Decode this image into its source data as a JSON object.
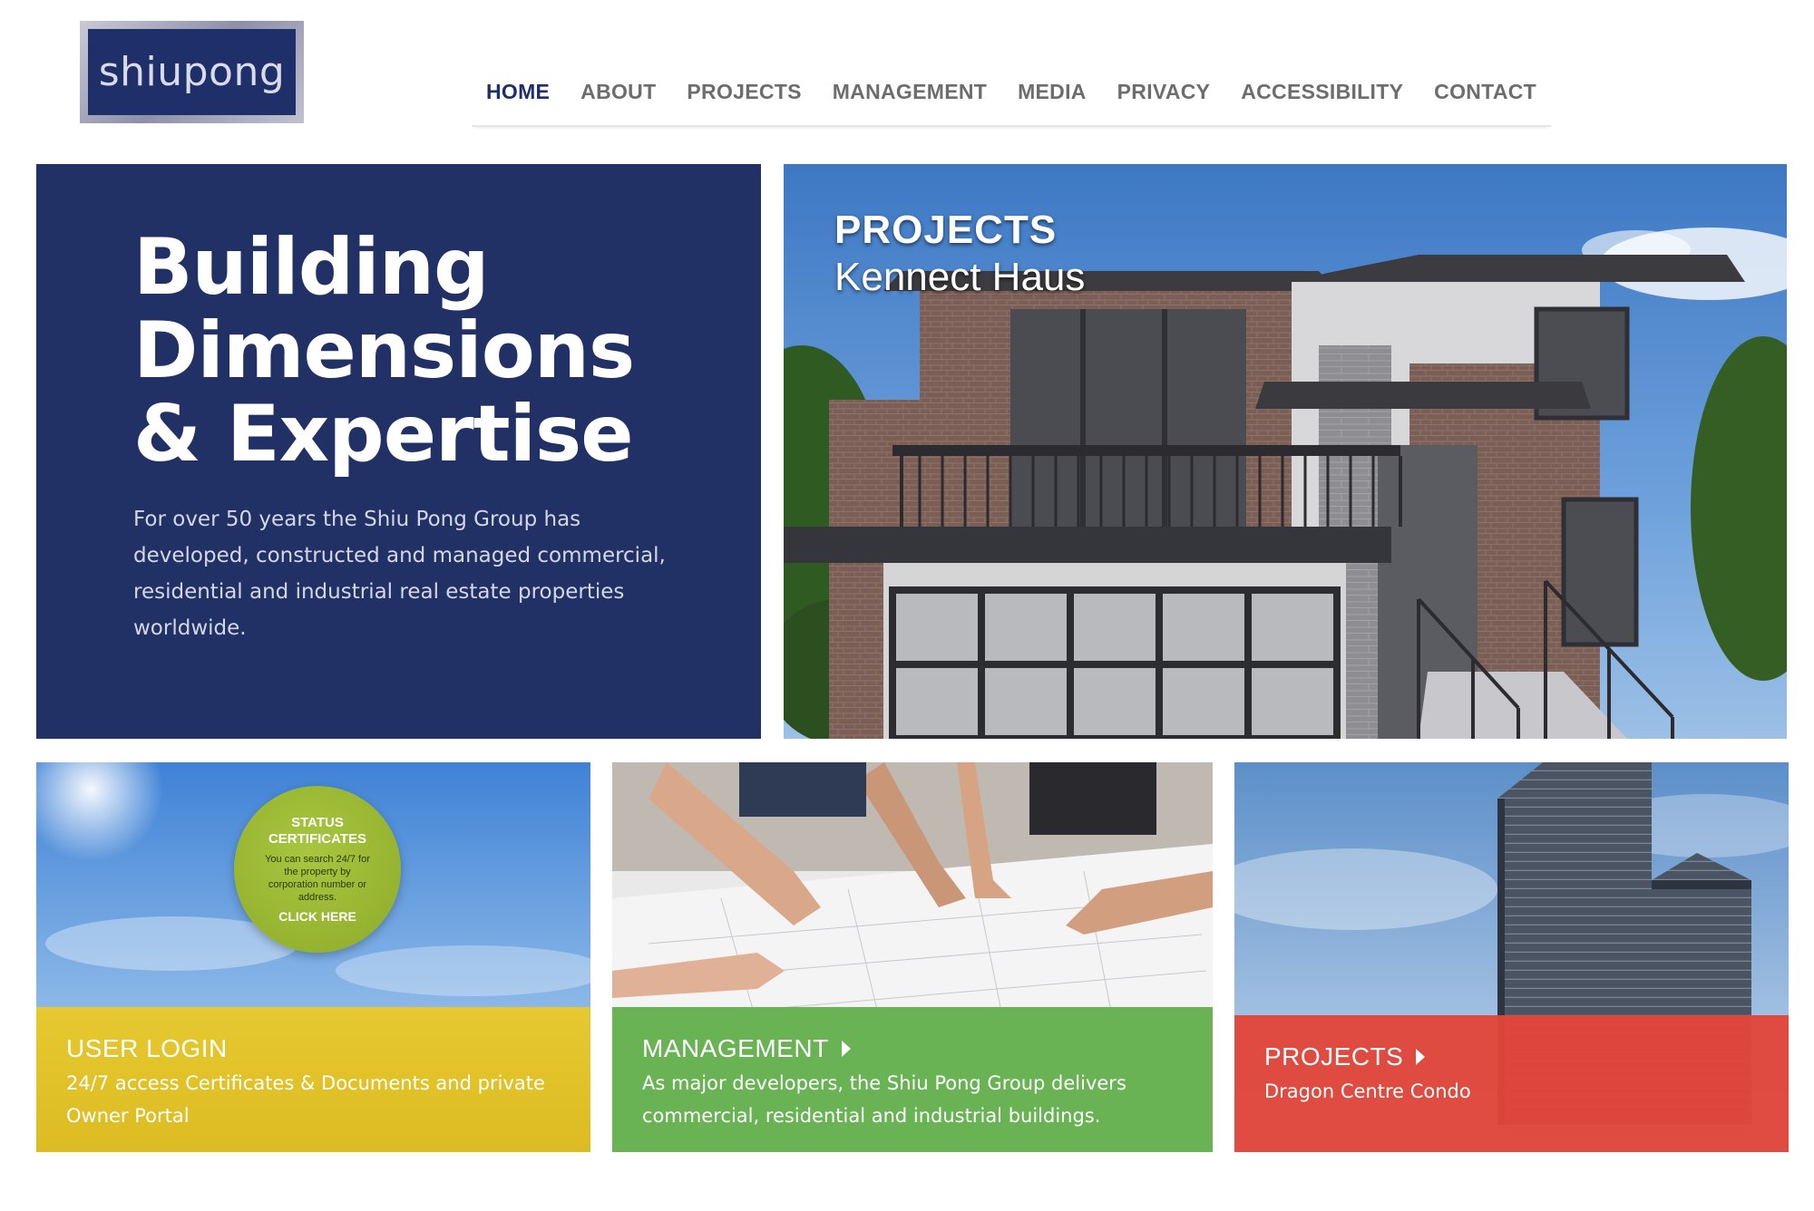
{
  "header": {
    "logo_text": "shiupong",
    "nav": [
      {
        "label": "HOME",
        "active": true
      },
      {
        "label": "ABOUT"
      },
      {
        "label": "PROJECTS"
      },
      {
        "label": "MANAGEMENT"
      },
      {
        "label": "MEDIA"
      },
      {
        "label": "PRIVACY"
      },
      {
        "label": "ACCESSIBILITY"
      },
      {
        "label": "CONTACT"
      }
    ]
  },
  "hero": {
    "title_line1": "Building",
    "title_line2": "Dimensions",
    "title_line3": "& Expertise",
    "text": "For over 50 years the Shiu Pong Group has developed, constructed and managed commercial, residential and industrial real estate properties worldwide.",
    "bg_color": "#213166"
  },
  "feature": {
    "label": "PROJECTS",
    "sublabel": "Kennect Haus"
  },
  "cards": {
    "login": {
      "title": "USER LOGIN",
      "text": "24/7 access Certificates & Documents and private Owner Portal",
      "badge_title": "STATUS CERTIFICATES",
      "badge_text": "You can search 24/7 for the property by corporation number or address.",
      "badge_cta": "CLICK HERE",
      "color": "#e2c22b"
    },
    "management": {
      "title": "MANAGEMENT",
      "text": "As major developers, the Shiu Pong Group delivers commercial, residential and industrial buildings.",
      "color": "#69b355"
    },
    "projects": {
      "title": "PROJECTS",
      "text": "Dragon Centre Condo",
      "color": "#e2463a"
    }
  }
}
